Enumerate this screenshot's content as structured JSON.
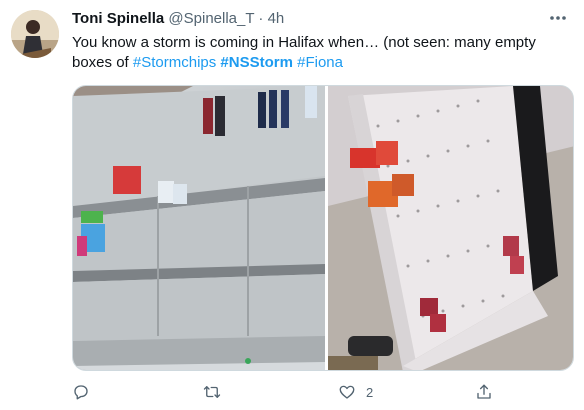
{
  "tweet": {
    "author_name": "Toni Spinella",
    "handle": "@Spinella_T",
    "separator": "·",
    "time": "4h",
    "text_part1": "You know a storm is coming in Halifax when… (not seen: many empty boxes of ",
    "hashtag1": "#Stormchips",
    "hashtag2": "#NSStorm",
    "hashtag3": "#Fiona",
    "space": " "
  },
  "actions": {
    "reply_count": "",
    "retweet_count": "",
    "like_count": "2",
    "share_count": ""
  },
  "icons": {
    "more": "more-dots-icon",
    "reply": "reply-icon",
    "retweet": "retweet-icon",
    "like": "heart-icon",
    "share": "share-icon"
  },
  "colors": {
    "accent": "#1d9bf0",
    "text": "#0f1419",
    "secondary": "#536471"
  }
}
